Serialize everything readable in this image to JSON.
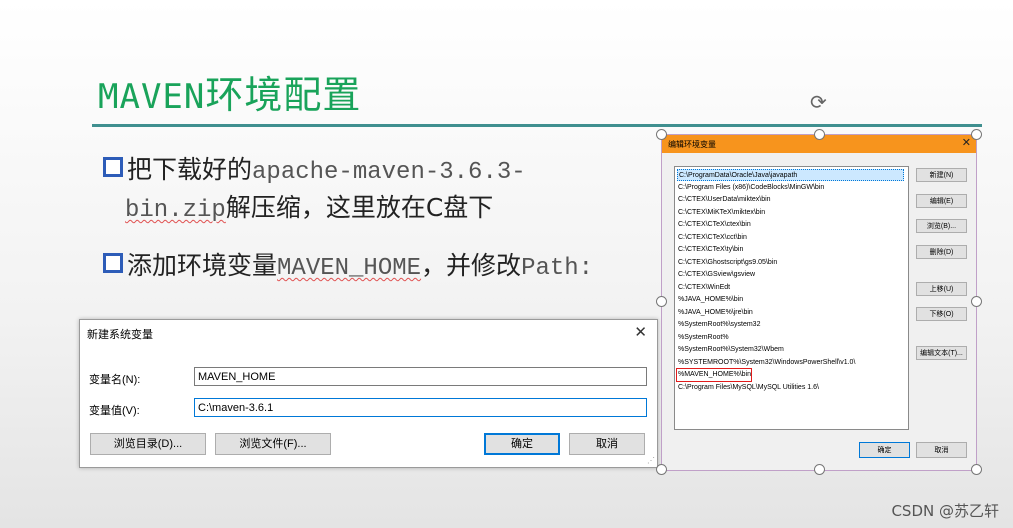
{
  "slide": {
    "title_latin": "MAVEN",
    "title_cjk": "环境配置",
    "bullet1_part1": "把下载好的",
    "bullet1_part2": "apache-maven-3.6.3-",
    "bullet1_part3": "bin.zip",
    "bullet1_part4": "解压缩，这里放在C盘下",
    "bullet2_part1": "添加环境变量",
    "bullet2_part2": "MAVEN_HOME",
    "bullet2_part3": "，并修改",
    "bullet2_part4": "Path:"
  },
  "new_var_dialog": {
    "title": "新建系统变量",
    "close": "✕",
    "name_label": "变量名(N):",
    "name_value": "MAVEN_HOME",
    "value_label": "变量值(V):",
    "value_value": "C:\\maven-3.6.1",
    "browse_dir": "浏览目录(D)...",
    "browse_file": "浏览文件(F)...",
    "ok": "确定",
    "cancel": "取消"
  },
  "edit_env_dialog": {
    "title": "编辑环境变量",
    "close": "✕",
    "paths": [
      "C:\\ProgramData\\Oracle\\Java\\javapath",
      "C:\\Program Files (x86)\\CodeBlocks\\MinGW\\bin",
      "C:\\CTEX\\UserData\\miktex\\bin",
      "C:\\CTEX\\MiKTeX\\miktex\\bin",
      "C:\\CTEX\\CTeX\\ctex\\bin",
      "C:\\CTEX\\CTeX\\cct\\bin",
      "C:\\CTEX\\CTeX\\ty\\bin",
      "C:\\CTEX\\Ghostscript\\gs9.05\\bin",
      "C:\\CTEX\\GSview\\gsview",
      "C:\\CTEX\\WinEdt",
      "%JAVA_HOME%\\bin",
      "%JAVA_HOME%\\jre\\bin",
      "%SystemRoot%\\system32",
      "%SystemRoot%",
      "%SystemRoot%\\System32\\Wbem",
      "%SYSTEMROOT%\\System32\\WindowsPowerShell\\v1.0\\",
      "%MAVEN_HOME%\\bin",
      "C:\\Program Files\\MySQL\\MySQL Utilities 1.6\\"
    ],
    "btn_new": "新建(N)",
    "btn_edit": "编辑(E)",
    "btn_browse": "浏览(B)...",
    "btn_delete": "删除(D)",
    "btn_up": "上移(U)",
    "btn_down": "下移(O)",
    "btn_edit_text": "编辑文本(T)...",
    "ok": "确定",
    "cancel": "取消"
  },
  "watermark": "CSDN @苏乙轩",
  "accent_color": "#19a35a",
  "highlight_color": "#e21b1b"
}
